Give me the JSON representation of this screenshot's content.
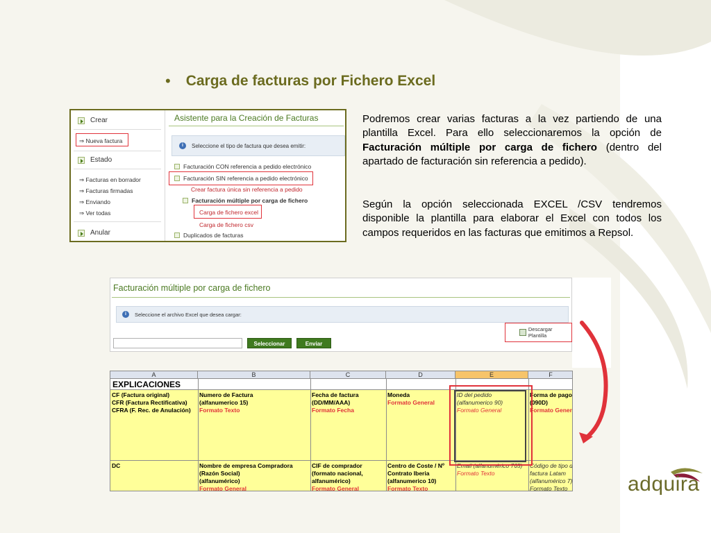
{
  "slide": {
    "bullet": "•",
    "title": "Carga de facturas por Fichero Excel",
    "p1": {
      "a": "Podremos crear varias facturas a la vez partiendo de una plantilla Excel. Para ello seleccionaremos la opción de ",
      "b1": "Facturación múltiple  por carga de fichero",
      "c": "  (dentro del apartado de facturación sin referencia a pedido)."
    },
    "p2": "Según la opción seleccionada EXCEL /CSV tendremos disponible la plantilla para elaborar el Excel con todos los campos requeridos en las facturas que emitimos a Repsol."
  },
  "shot1": {
    "sections": {
      "crear": "Crear",
      "estado": "Estado",
      "anular": "Anular"
    },
    "crear_items": [
      "⇒ Nueva factura"
    ],
    "estado_items": [
      "⇒ Facturas en borrador",
      "⇒ Facturas firmadas",
      "⇒ Enviando",
      "⇒ Ver todas"
    ],
    "header": "Asistente para la Creación de Facturas",
    "info": "Seleccione el tipo de factura que desea emitir:",
    "options": {
      "con_ref": "Facturación CON referencia a pedido electrónico",
      "sin_ref": "Facturación SIN referencia a pedido electrónico",
      "unica": "Crear factura única sin referencia a pedido",
      "multiple": "Facturación múltiple por carga de fichero",
      "excel": "Carga de fichero excel",
      "csv": "Carga de fichero csv",
      "duplicados": "Duplicados de facturas"
    }
  },
  "shot2": {
    "header": "Facturación múltiple por carga de fichero",
    "info": "Seleccione el archivo Excel que desea cargar:",
    "file_value": "",
    "btn_select": "Seleccionar",
    "btn_send": "Enviar",
    "download": "Descargar Plantilla"
  },
  "excel": {
    "columns": [
      "A",
      "B",
      "C",
      "D",
      "E",
      "F"
    ],
    "explicaciones": "EXPLICACIONES",
    "row2": {
      "a": [
        "CF (Factura original)",
        "CFR (Factura Rectificativa)",
        "CFRA (F. Rec. de Anulación)"
      ],
      "b": [
        "Numero de Factura",
        "(alfanumerico 15)",
        "Formato Texto"
      ],
      "c": [
        "Fecha de factura",
        "(DD/MM/AAA)",
        "Formato Fecha"
      ],
      "d": [
        "Moneda",
        "Formato General"
      ],
      "e": [
        "ID del pedido",
        "(alfanumerico 90)",
        "Formato General"
      ],
      "f": [
        "Forma de pago",
        "(090D)",
        "Formato General"
      ]
    },
    "row3": {
      "a": "DC",
      "b": [
        "Nombre de empresa Compradora",
        "(Razón Social)",
        "(alfanumérico)",
        "Formato General"
      ],
      "c": [
        "CIF de comprador",
        "(formato nacional,",
        "alfanumérico)",
        "Formato General"
      ],
      "d": [
        "Centro de Coste / Nº",
        "Contrato Iberia",
        "(alfanumerico 10)",
        "Formato Texto"
      ],
      "e": [
        "Email (alfanumérico 765)",
        "Formato Texto"
      ],
      "f": [
        "Código de tipo de",
        "factura Latam",
        "(alfanumérico 7)",
        "Formato Texto"
      ]
    }
  },
  "logo": {
    "text": "adquira"
  },
  "colors": {
    "title": "#6b6b1f",
    "highlight": "#e0323a",
    "excel_yellow": "#ffff99"
  }
}
